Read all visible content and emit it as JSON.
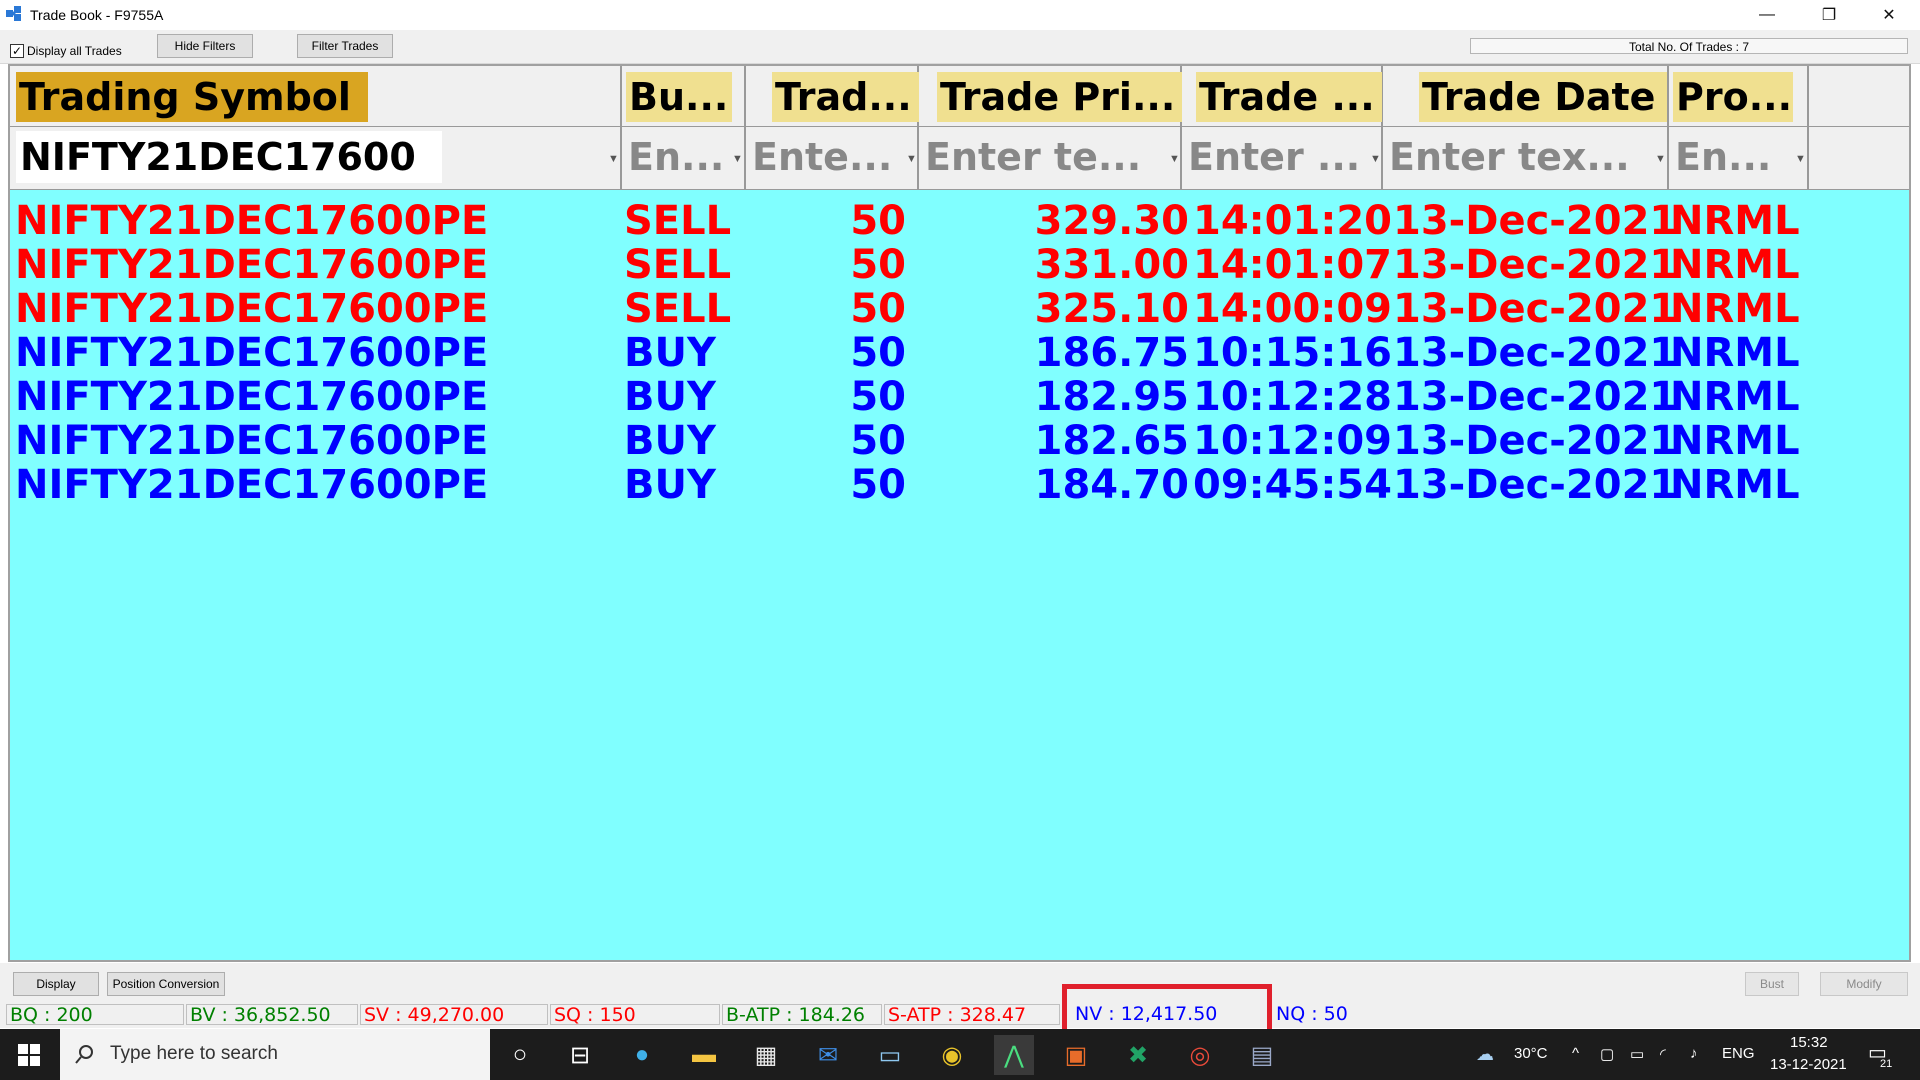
{
  "window": {
    "title": "Trade Book - F9755A",
    "minimize": "—",
    "restore": "❐",
    "close": "✕"
  },
  "toolbar": {
    "display_all_checked": "✓",
    "display_all_label": "Display all Trades",
    "hide_filters_label": "Hide Filters",
    "filter_trades_label": "Filter Trades",
    "total_trades": "Total No. Of Trades : 7"
  },
  "grid": {
    "columns": [
      {
        "label": "Trading Symbol",
        "filter_value": "NIFTY21DEC17600",
        "filter_placeholder": ""
      },
      {
        "label": "Bu...",
        "filter_value": "",
        "filter_placeholder": "En..."
      },
      {
        "label": "Trad...",
        "filter_value": "",
        "filter_placeholder": "Ente..."
      },
      {
        "label": "Trade Pri...",
        "filter_value": "",
        "filter_placeholder": "Enter te..."
      },
      {
        "label": "Trade ...",
        "filter_value": "",
        "filter_placeholder": "Enter ..."
      },
      {
        "label": "Trade Date",
        "filter_value": "",
        "filter_placeholder": "Enter tex..."
      },
      {
        "label": "Pro...",
        "filter_value": "",
        "filter_placeholder": "En..."
      }
    ],
    "rows": [
      {
        "symbol": "NIFTY21DEC17600PE",
        "side": "SELL",
        "qty": "50",
        "price": "329.30",
        "time": "14:01:20",
        "date": "13-Dec-2021",
        "product": "NRML"
      },
      {
        "symbol": "NIFTY21DEC17600PE",
        "side": "SELL",
        "qty": "50",
        "price": "331.00",
        "time": "14:01:07",
        "date": "13-Dec-2021",
        "product": "NRML"
      },
      {
        "symbol": "NIFTY21DEC17600PE",
        "side": "SELL",
        "qty": "50",
        "price": "325.10",
        "time": "14:00:09",
        "date": "13-Dec-2021",
        "product": "NRML"
      },
      {
        "symbol": "NIFTY21DEC17600PE",
        "side": "BUY",
        "qty": "50",
        "price": "186.75",
        "time": "10:15:16",
        "date": "13-Dec-2021",
        "product": "NRML"
      },
      {
        "symbol": "NIFTY21DEC17600PE",
        "side": "BUY",
        "qty": "50",
        "price": "182.95",
        "time": "10:12:28",
        "date": "13-Dec-2021",
        "product": "NRML"
      },
      {
        "symbol": "NIFTY21DEC17600PE",
        "side": "BUY",
        "qty": "50",
        "price": "182.65",
        "time": "10:12:09",
        "date": "13-Dec-2021",
        "product": "NRML"
      },
      {
        "symbol": "NIFTY21DEC17600PE",
        "side": "BUY",
        "qty": "50",
        "price": "184.70",
        "time": "09:45:54",
        "date": "13-Dec-2021",
        "product": "NRML"
      }
    ]
  },
  "bottom": {
    "display_label": "Display",
    "position_conversion_label": "Position Conversion",
    "bust_label": "Bust",
    "modify_label": "Modify",
    "stats": {
      "bq": "BQ : 200",
      "bv": "BV : 36,852.50",
      "sv": "SV : 49,270.00",
      "sq": "SQ : 150",
      "batp": "B-ATP : 184.26",
      "satp": "S-ATP : 328.47",
      "nv": "NV : 12,417.50",
      "nq": "NQ : 50"
    }
  },
  "taskbar": {
    "search_placeholder": "Type here to search",
    "temperature": "30°C",
    "language": "ENG",
    "time": "15:32",
    "date": "13-12-2021",
    "notifications": "21"
  },
  "colors": {
    "sell": "#ff0000",
    "buy": "#0000ff",
    "grid_bg": "#80ffff",
    "header_highlight": "#f0e090",
    "sorted_header": "#d9a521",
    "stat_green": "#008000",
    "stat_red": "#ff0000",
    "stat_blue": "#0000ff",
    "highlight_box": "#e0202c"
  }
}
